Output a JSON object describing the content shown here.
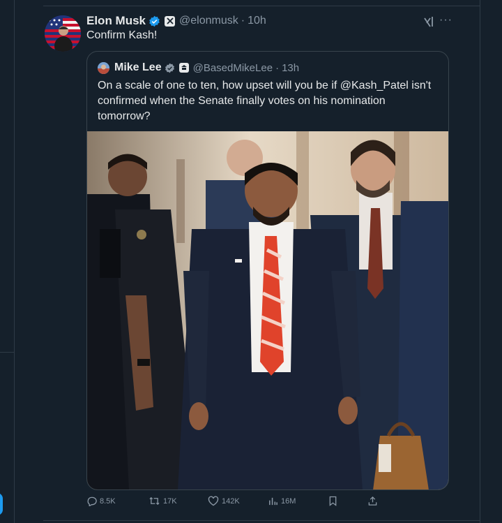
{
  "post": {
    "author_name": "Elon Musk",
    "author_handle": "@elonmusk",
    "time": "10h",
    "text": "Confirm Kash!"
  },
  "quoted": {
    "author_name": "Mike Lee",
    "author_handle": "@BasedMikeLee",
    "time": "13h",
    "text": "On a scale of one to ten, how upset will you be if @Kash_Patel isn't confirmed when the Senate finally votes on his nomination tomorrow?"
  },
  "actions": {
    "replies": "8.5K",
    "reposts": "17K",
    "likes": "142K",
    "views": "16M"
  },
  "icons": [
    "verified-icon",
    "x-affiliate-badge",
    "grok-icon",
    "more-icon",
    "reply-icon",
    "repost-icon",
    "like-icon",
    "views-icon",
    "bookmark-icon",
    "share-icon"
  ],
  "colors": {
    "background": "#15202b",
    "text": "#e7e9ea",
    "muted": "#8b98a5",
    "verified": "#1d9bf0",
    "border": "#38444d"
  }
}
